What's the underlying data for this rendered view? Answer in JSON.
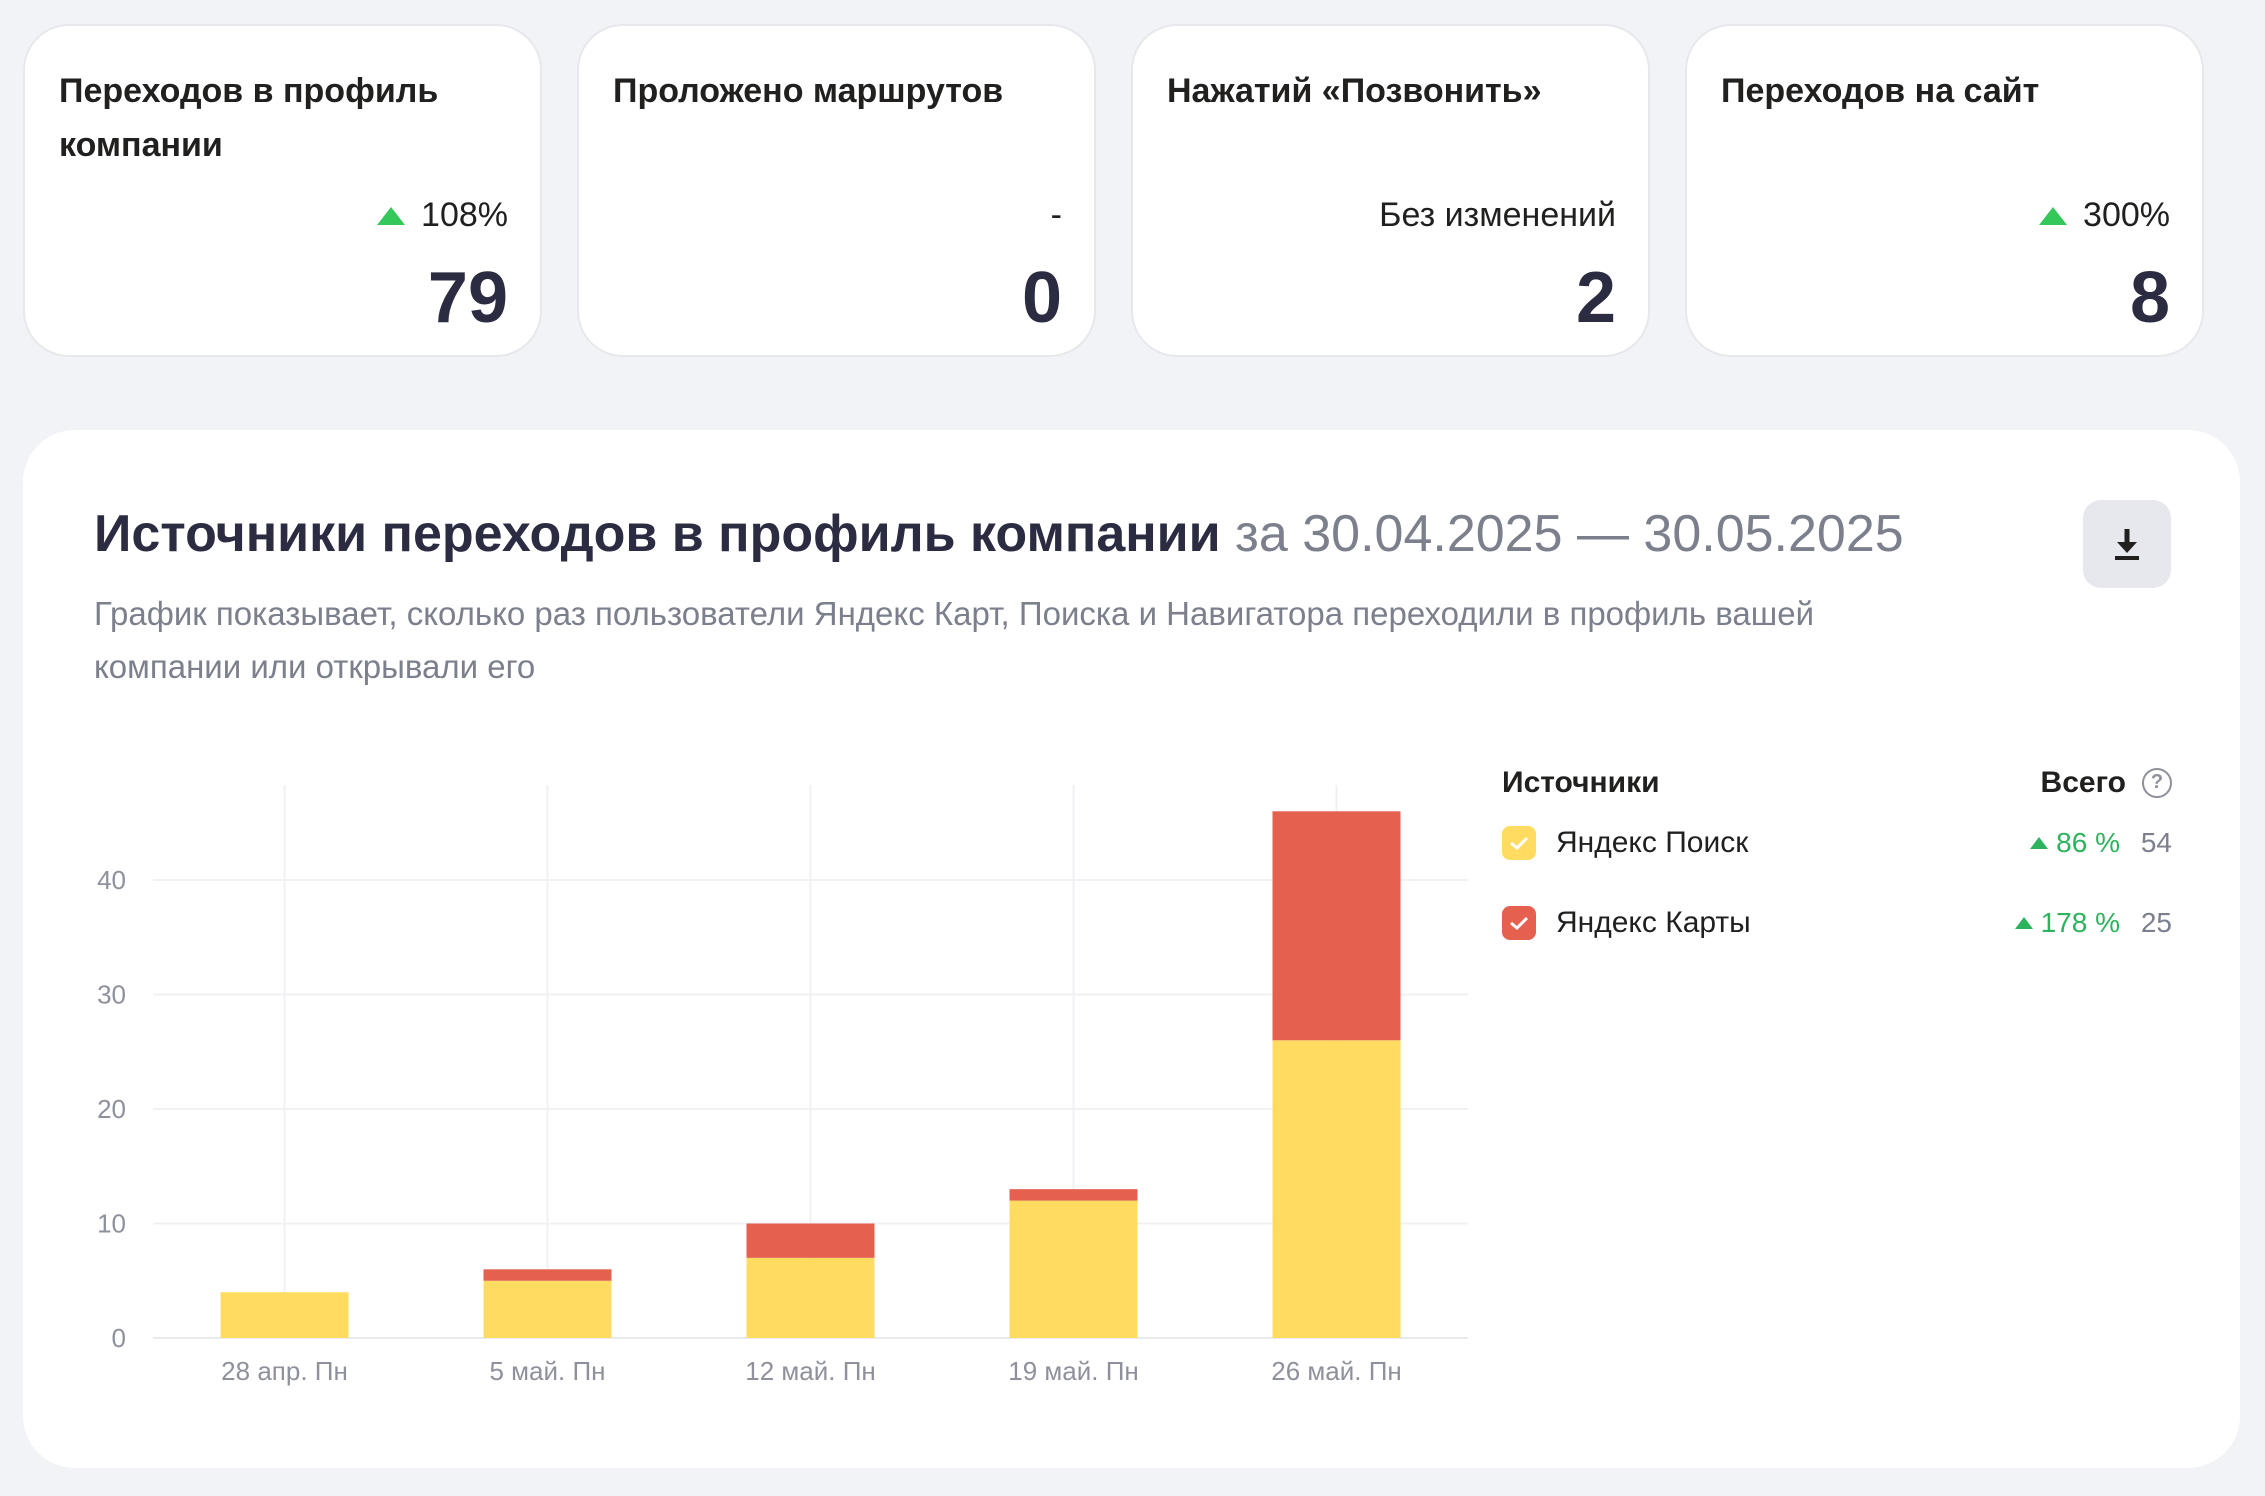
{
  "kpis": [
    {
      "title": "Переходов в профиль компании",
      "change": "108%",
      "change_dir": "up",
      "value": "79"
    },
    {
      "title": "Проложено маршрутов",
      "change": "-",
      "change_dir": "none",
      "value": "0"
    },
    {
      "title": "Нажатий «Позвонить»",
      "change": "Без изменений",
      "change_dir": "none",
      "value": "2"
    },
    {
      "title": "Переходов на сайт",
      "change": "300%",
      "change_dir": "up",
      "value": "8"
    }
  ],
  "panel": {
    "title": "Источники переходов в профиль компании",
    "period": "за 30.04.2025 — 30.05.2025",
    "description": "График показывает, сколько раз пользователи Яндекс Карт, Поиска и Навигатора переходили в профиль вашей компании или открывали его",
    "download_icon": "download-icon"
  },
  "legend": {
    "sources_header": "Источники",
    "total_header": "Всего",
    "help_icon": "?",
    "items": [
      {
        "label": "Яндекс Поиск",
        "pct": "86 %",
        "total": "54",
        "color": "#ffdc60"
      },
      {
        "label": "Яндекс Карты",
        "pct": "178 %",
        "total": "25",
        "color": "#e5604f"
      }
    ]
  },
  "colors": {
    "search": "#ffdc60",
    "maps": "#e5604f",
    "growth": "#2db35d",
    "accent_dark": "#2b2c42"
  },
  "chart_data": {
    "type": "bar",
    "stacked": true,
    "categories": [
      "28 апр. Пн",
      "5 май. Пн",
      "12 май. Пн",
      "19 май. Пн",
      "26 май. Пн"
    ],
    "series": [
      {
        "name": "Яндекс Поиск",
        "values": [
          4,
          5,
          7,
          12,
          26
        ],
        "color": "#ffdc60"
      },
      {
        "name": "Яндекс Карты",
        "values": [
          0,
          1,
          3,
          1,
          20
        ],
        "color": "#e5604f"
      }
    ],
    "yticks": [
      0,
      10,
      20,
      30,
      40
    ],
    "ylim": [
      0,
      48
    ],
    "grid": true
  }
}
